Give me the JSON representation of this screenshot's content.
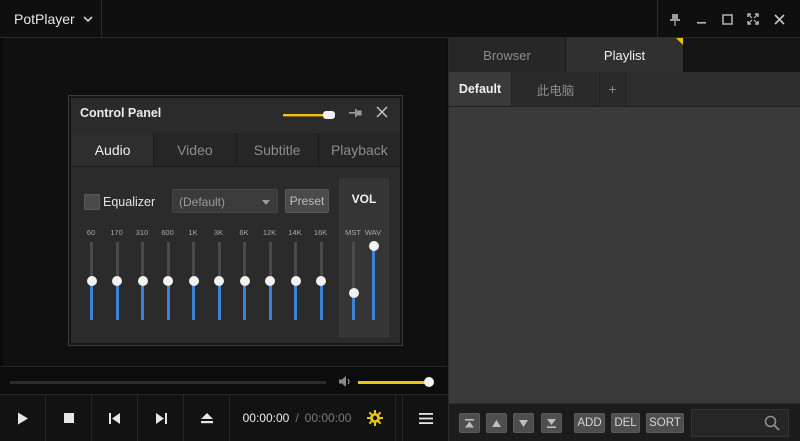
{
  "app": {
    "title": "PotPlayer"
  },
  "colors": {
    "accent": "#e8c417",
    "eq_fill": "#3b82d8"
  },
  "control_panel": {
    "title": "Control Panel",
    "tabs": [
      "Audio",
      "Video",
      "Subtitle",
      "Playback"
    ],
    "active_tab": "Audio",
    "equalizer_label": "Equalizer",
    "equalizer_enabled": false,
    "preset_select_value": "(Default)",
    "preset_button": "Preset",
    "vol_label": "VOL",
    "bands": [
      {
        "label": "60",
        "level": 0.5
      },
      {
        "label": "170",
        "level": 0.5
      },
      {
        "label": "310",
        "level": 0.5
      },
      {
        "label": "600",
        "level": 0.5
      },
      {
        "label": "1K",
        "level": 0.5
      },
      {
        "label": "3K",
        "level": 0.5
      },
      {
        "label": "6K",
        "level": 0.5
      },
      {
        "label": "12K",
        "level": 0.5
      },
      {
        "label": "14K",
        "level": 0.5
      },
      {
        "label": "16K",
        "level": 0.5
      }
    ],
    "vol_channels": [
      {
        "label": "MST",
        "level": 0.35
      },
      {
        "label": "WAV",
        "level": 0.95
      }
    ]
  },
  "playback": {
    "time_current": "00:00:00",
    "time_separator": "/",
    "time_duration": "00:00:00",
    "volume_level": 0.98,
    "seek_level": 0
  },
  "playlist_panel": {
    "tabs": [
      "Browser",
      "Playlist"
    ],
    "active_tab": "Playlist",
    "subtabs": [
      "Default",
      "此电脑",
      "+"
    ],
    "active_subtab": "Default",
    "buttons": {
      "add": "ADD",
      "del": "DEL",
      "sort": "SORT"
    },
    "search_placeholder": ""
  },
  "icons": [
    "chevron-down-icon",
    "pin-icon",
    "minimize-icon",
    "maximize-icon",
    "fullscreen-icon",
    "close-icon",
    "play-icon",
    "stop-icon",
    "previous-icon",
    "next-icon",
    "eject-icon",
    "settings-gear-icon",
    "menu-icon",
    "mute-speaker-icon",
    "search-icon",
    "move-top-icon",
    "move-up-icon",
    "move-down-icon",
    "move-bottom-icon"
  ]
}
